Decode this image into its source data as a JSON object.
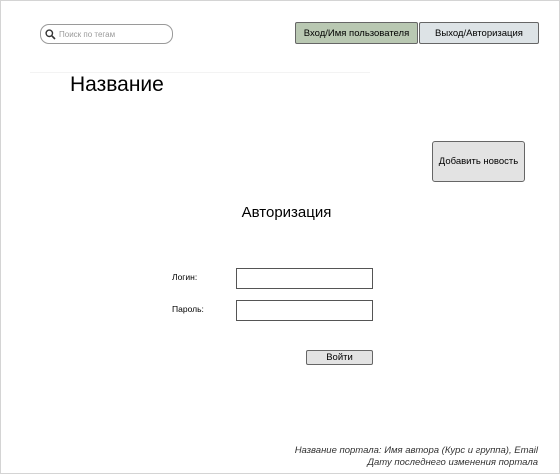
{
  "header": {
    "search": {
      "placeholder": "Поиск по тегам",
      "icon": "search-icon"
    },
    "login_button": "Вход/Имя пользователя",
    "logout_button": "Выход/Авторизация"
  },
  "page_title": "Название",
  "add_news_button": "Добавить новость",
  "auth": {
    "heading": "Авторизация",
    "login_label": "Логин:",
    "login_value": "",
    "password_label": "Пароль:",
    "password_value": "",
    "submit_button": "Войти"
  },
  "footer": {
    "line1": "Название портала: Имя автора (Курс и группа), Email",
    "line2": "Дату последнего изменения портала"
  },
  "colors": {
    "login_button_bg": "#b9c8b2",
    "logout_button_bg": "#dde3e6",
    "neutral_button_bg": "#e3e3e3"
  }
}
